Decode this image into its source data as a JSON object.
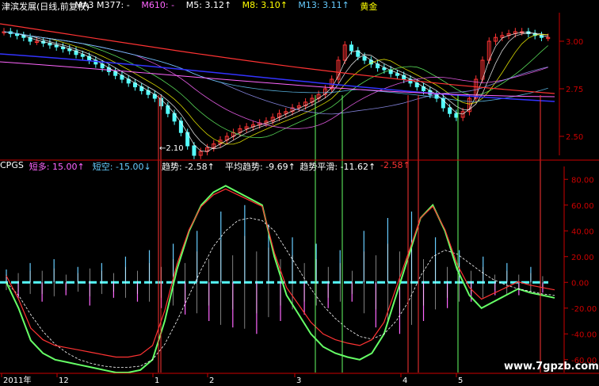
{
  "top_legend": {
    "items": [
      {
        "text": "津滨发展(日线,前复权)",
        "color": "#ffffff"
      },
      {
        "text": "MA3",
        "color": "#ffffff"
      },
      {
        "text": "M377: -",
        "color": "#ffffff"
      },
      {
        "text": "M610: -",
        "color": "#ff66ff"
      },
      {
        "text": "M5: 3.12↑",
        "color": "#ffffff"
      },
      {
        "text": "M8: 3.10↑",
        "color": "#ffff00"
      },
      {
        "text": "M13: 3.11↑",
        "color": "#66ccff"
      },
      {
        "text": "黄金",
        "color": "#ffff00"
      }
    ]
  },
  "indicator_legend": {
    "items": [
      {
        "text": "CPGS",
        "color": "#ffffff"
      },
      {
        "text": "短多: 15.00↑",
        "color": "#ff66ff"
      },
      {
        "text": "短空: -15.00↓",
        "color": "#66ccff"
      },
      {
        "text": "趋势: -2.58↑",
        "color": "#ffffff"
      },
      {
        "text": "平均趋势: -9.69↑",
        "color": "#ffffff"
      },
      {
        "text": "趋势平滑: -11.62↑",
        "color": "#ffffff"
      },
      {
        "text": "-2.58↑",
        "color": "#ff3333"
      }
    ]
  },
  "low_annotation": "←2.10",
  "watermark": "www.7gpzb.com",
  "chart_data": [
    {
      "type": "line",
      "name": "price",
      "y_ticks": [
        "3.00",
        "2.75",
        "2.50"
      ],
      "ylim": [
        2.4,
        3.15
      ],
      "ma_series_colors": [
        "#ff3333",
        "#ffffff",
        "#ffff00",
        "#66ff66",
        "#ff66ff",
        "#3333ff"
      ],
      "close": [
        3.05,
        3.04,
        3.03,
        3.02,
        3.0,
        3.0,
        2.99,
        2.98,
        2.97,
        2.96,
        2.95,
        2.93,
        2.92,
        2.9,
        2.88,
        2.86,
        2.84,
        2.82,
        2.8,
        2.78,
        2.76,
        2.74,
        2.72,
        2.7,
        2.66,
        2.62,
        2.58,
        2.52,
        2.45,
        2.4,
        2.42,
        2.44,
        2.46,
        2.48,
        2.5,
        2.52,
        2.54,
        2.55,
        2.56,
        2.57,
        2.58,
        2.6,
        2.62,
        2.63,
        2.65,
        2.66,
        2.68,
        2.7,
        2.72,
        2.75,
        2.8,
        2.9,
        2.98,
        2.95,
        2.92,
        2.9,
        2.88,
        2.86,
        2.85,
        2.83,
        2.82,
        2.8,
        2.78,
        2.76,
        2.74,
        2.72,
        2.7,
        2.65,
        2.62,
        2.6,
        2.63,
        2.7,
        2.8,
        2.9,
        3.0,
        3.02,
        3.03,
        3.04,
        3.05,
        3.05,
        3.04,
        3.03,
        3.02,
        3.02
      ]
    },
    {
      "type": "line",
      "name": "CPGS",
      "y_ticks": [
        "80.00",
        "60.00",
        "40.00",
        "20.00",
        "0.00",
        "-20.00",
        "-40.00",
        "-60.00"
      ],
      "ylim": [
        -70,
        90
      ],
      "x_ticks": [
        "2011年",
        "12",
        "1",
        "2",
        "3",
        "4",
        "5"
      ],
      "trend": [
        0,
        -20,
        -45,
        -55,
        -60,
        -62,
        -64,
        -66,
        -68,
        -70,
        -70,
        -68,
        -60,
        -30,
        10,
        40,
        60,
        70,
        75,
        70,
        65,
        60,
        20,
        -10,
        -25,
        -40,
        -50,
        -55,
        -58,
        -60,
        -55,
        -40,
        -10,
        20,
        50,
        60,
        40,
        10,
        -10,
        -20,
        -15,
        -10,
        -5,
        -8,
        -10,
        -12
      ],
      "avg_trend": [
        0,
        -10,
        -25,
        -38,
        -48,
        -55,
        -60,
        -63,
        -65,
        -66,
        -66,
        -65,
        -60,
        -48,
        -30,
        -10,
        10,
        28,
        40,
        48,
        50,
        48,
        40,
        25,
        10,
        -5,
        -18,
        -28,
        -36,
        -42,
        -44,
        -40,
        -30,
        -15,
        5,
        20,
        25,
        22,
        15,
        8,
        2,
        -2,
        -5,
        -7,
        -9,
        -10
      ],
      "short": [
        10,
        -12,
        15,
        -15,
        18,
        -10,
        12,
        -18,
        15,
        -12,
        20,
        -15,
        25,
        -20,
        30,
        -25,
        40,
        -30,
        55,
        -35,
        60,
        -40,
        45,
        -30,
        35,
        -25,
        30,
        -20,
        25,
        -15,
        40,
        -35,
        50,
        -40,
        55,
        -30,
        35,
        -20,
        25,
        -15,
        20,
        -10,
        15,
        -10,
        12,
        -8
      ]
    }
  ]
}
